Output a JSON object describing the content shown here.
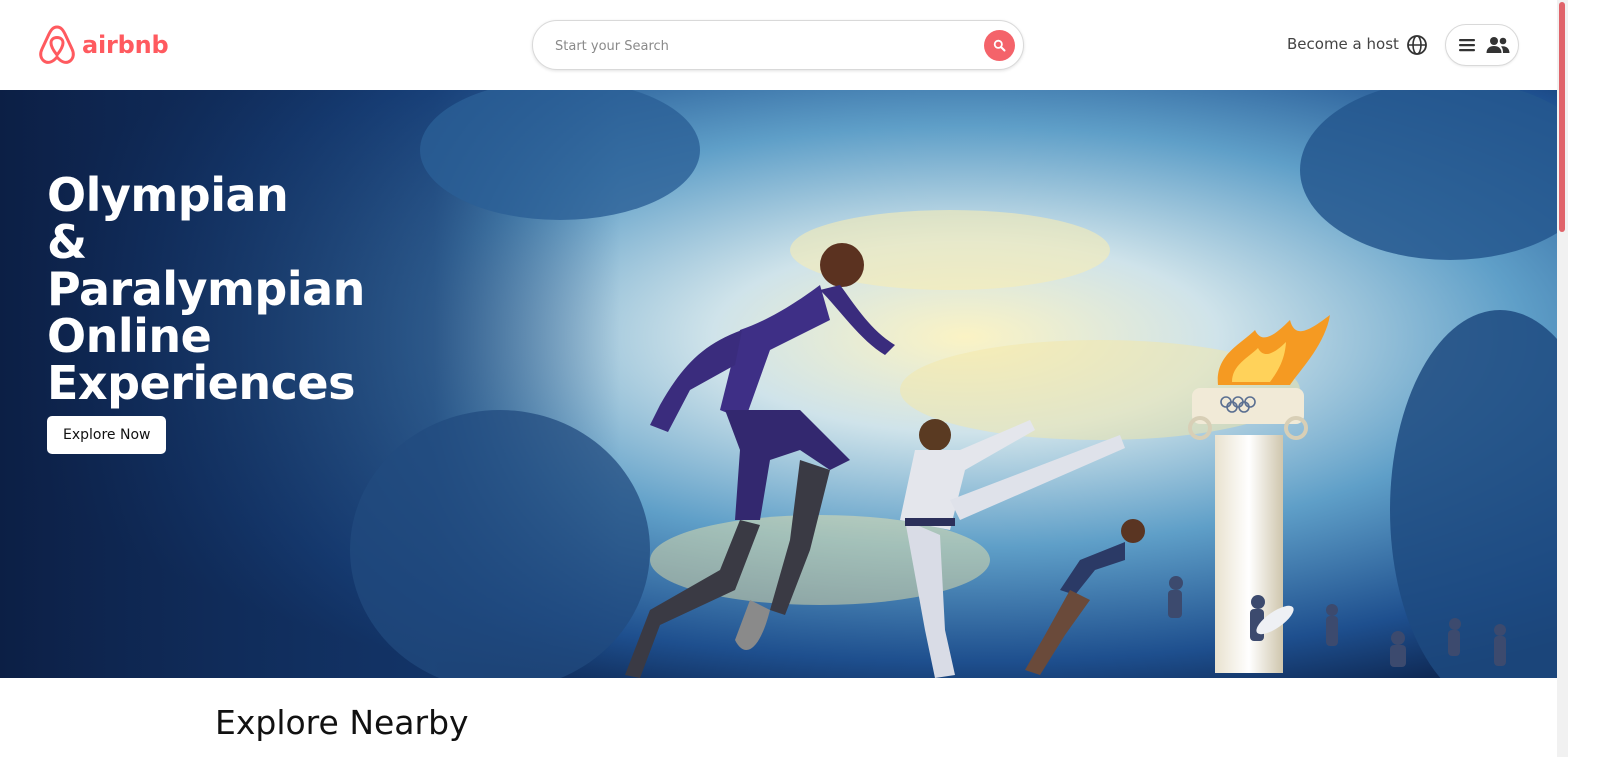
{
  "header": {
    "logo_text": "airbnb",
    "search": {
      "placeholder": "Start your Search",
      "value": ""
    },
    "host_link": "Become a host"
  },
  "hero": {
    "title_lines": [
      "Olympian",
      "&",
      "Paralympian",
      "Online",
      "Experiences"
    ],
    "cta_label": "Explore Now"
  },
  "section": {
    "title": "Explore Nearby"
  },
  "icons": {
    "logo": "airbnb-logo-icon",
    "search": "search-icon",
    "globe": "globe-icon",
    "menu": "menu-icon",
    "people": "people-icon"
  },
  "colors": {
    "brand": "#ff5a5f",
    "search_button": "#f4636a"
  }
}
